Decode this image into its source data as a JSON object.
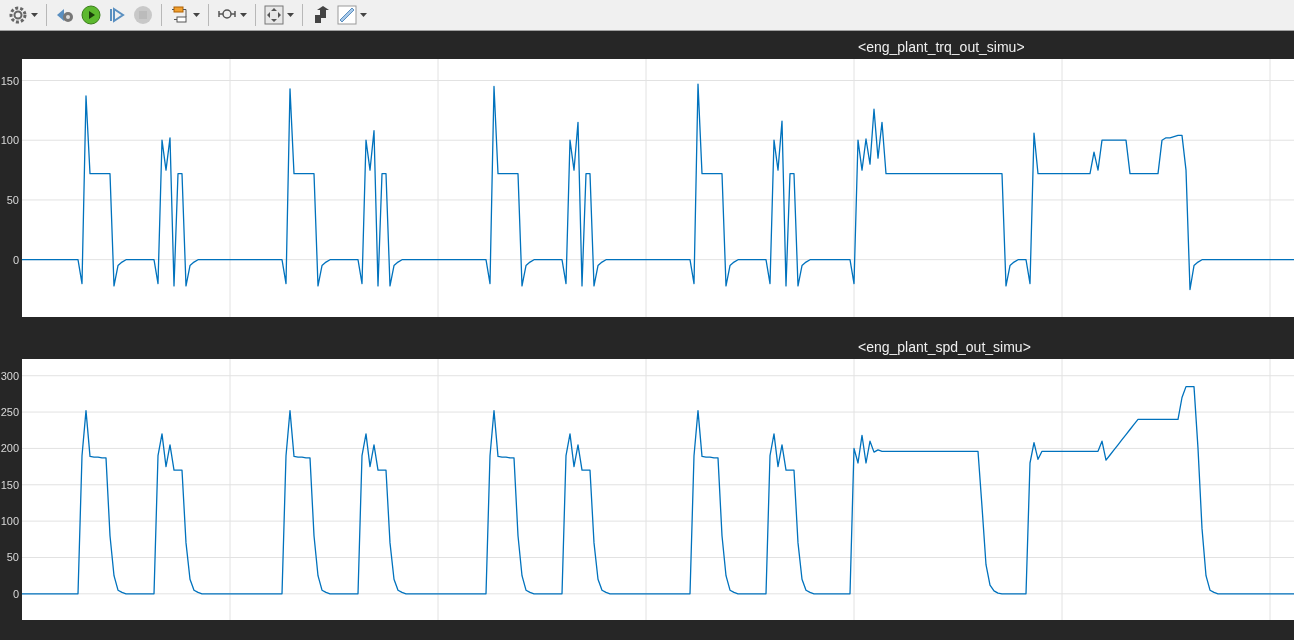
{
  "toolbar": {
    "groups": [
      [
        {
          "kind": "settings",
          "dropdown": true,
          "disabled": false
        }
      ],
      [
        {
          "kind": "step-back",
          "dropdown": false,
          "disabled": false
        },
        {
          "kind": "run",
          "dropdown": false,
          "disabled": false
        },
        {
          "kind": "step-forward",
          "dropdown": false,
          "disabled": false
        },
        {
          "kind": "stop",
          "dropdown": false,
          "disabled": true
        }
      ],
      [
        {
          "kind": "blocks",
          "dropdown": true,
          "disabled": false
        }
      ],
      [
        {
          "kind": "zoom",
          "dropdown": true,
          "disabled": false
        }
      ],
      [
        {
          "kind": "fit",
          "dropdown": true,
          "disabled": false
        }
      ],
      [
        {
          "kind": "style",
          "dropdown": false,
          "disabled": false
        },
        {
          "kind": "ruler",
          "dropdown": true,
          "disabled": false
        }
      ]
    ]
  },
  "plots": [
    {
      "title": "<eng_plant_trq_out_simu>",
      "chart_data": {
        "type": "line",
        "grid": true,
        "ylim": [
          -48,
          168
        ],
        "yticks": [
          {
            "value": 0,
            "label": "0"
          },
          {
            "value": 50,
            "label": "50"
          },
          {
            "value": 100,
            "label": "100"
          },
          {
            "value": 150,
            "label": "150"
          }
        ],
        "categories": [
          null,
          null,
          null,
          null,
          null,
          null,
          null,
          null,
          null,
          null,
          null,
          null,
          null,
          null,
          null,
          null,
          null,
          null,
          null,
          null,
          null,
          null,
          null,
          null,
          null,
          null,
          null,
          null,
          null,
          null,
          null,
          null,
          null,
          null,
          null,
          null,
          null,
          null,
          null,
          null,
          null,
          null,
          null,
          null,
          null,
          null,
          null,
          null,
          null,
          null,
          null,
          null,
          null,
          null,
          null,
          null,
          null,
          null,
          null,
          null,
          null,
          null,
          null,
          null,
          null,
          null,
          null,
          null,
          null,
          null,
          null,
          null,
          null,
          null,
          null,
          null,
          null,
          null,
          null,
          null,
          null,
          null,
          null,
          null,
          null,
          null,
          null,
          null,
          null,
          null,
          null,
          null,
          null,
          null,
          null,
          null,
          null,
          null,
          null,
          null,
          null,
          null,
          null,
          null,
          null,
          null,
          null,
          null,
          null,
          null,
          null,
          null,
          null,
          null,
          null,
          null,
          null,
          null,
          null,
          null,
          null,
          null,
          null,
          null,
          null,
          null,
          null,
          null,
          null,
          null,
          null,
          null,
          null,
          null,
          null,
          null,
          null,
          null,
          null,
          null,
          null,
          null,
          null,
          null,
          null,
          null,
          null,
          null,
          null,
          null,
          null,
          null,
          null,
          null,
          null,
          null,
          null,
          null,
          null,
          null,
          null,
          null,
          null,
          null,
          null,
          null,
          null,
          null,
          null,
          null,
          null,
          null,
          null,
          null,
          null,
          null,
          null,
          null,
          null,
          null,
          null,
          null,
          null,
          null,
          null,
          null,
          null,
          null,
          null,
          null,
          null,
          null,
          null,
          null,
          null,
          null,
          null,
          null,
          null,
          null,
          null,
          null,
          null,
          null,
          null,
          null,
          null,
          null,
          null,
          null,
          null,
          null,
          null,
          null,
          null,
          null,
          null,
          null,
          null,
          null,
          null,
          null,
          null,
          null,
          null,
          null,
          null,
          null,
          null,
          null,
          null,
          null,
          null,
          null,
          null,
          null,
          null,
          null,
          null,
          null,
          null,
          null,
          null,
          null,
          null,
          null,
          null,
          null,
          null,
          null,
          null,
          null,
          null,
          null,
          null,
          null,
          null,
          null,
          null,
          null,
          null,
          null,
          null,
          null,
          null,
          null,
          null,
          null,
          null,
          null,
          null,
          null,
          null,
          null,
          null,
          null,
          null,
          null,
          null,
          null,
          null,
          null,
          null,
          null,
          null,
          null,
          null,
          null,
          null,
          null,
          null,
          null,
          null,
          null,
          null,
          null,
          null,
          null,
          null,
          null,
          null,
          null,
          null,
          null,
          null,
          null,
          null,
          null,
          null,
          null,
          null,
          null,
          null,
          null,
          null,
          null,
          null,
          null,
          null
        ],
        "series": [
          {
            "color": "#0072bd",
            "values": [
              0,
              0,
              0,
              0,
              0,
              0,
              0,
              0,
              0,
              0,
              0,
              0,
              0,
              0,
              0,
              -20,
              137,
              72,
              72,
              72,
              72,
              72,
              72,
              -22,
              -5,
              -2,
              0,
              0,
              0,
              0,
              0,
              0,
              0,
              0,
              -20,
              100,
              75,
              102,
              -22,
              72,
              72,
              -22,
              -5,
              -2,
              0,
              0,
              0,
              0,
              0,
              0,
              0,
              0,
              0,
              0,
              0,
              0,
              0,
              0,
              0,
              0,
              0,
              0,
              0,
              0,
              0,
              0,
              -20,
              143,
              72,
              72,
              72,
              72,
              72,
              72,
              -22,
              -5,
              -2,
              0,
              0,
              0,
              0,
              0,
              0,
              0,
              0,
              -20,
              100,
              75,
              108,
              -22,
              72,
              72,
              -22,
              -5,
              -2,
              0,
              0,
              0,
              0,
              0,
              0,
              0,
              0,
              0,
              0,
              0,
              0,
              0,
              0,
              0,
              0,
              0,
              0,
              0,
              0,
              0,
              0,
              -20,
              145,
              72,
              72,
              72,
              72,
              72,
              72,
              -22,
              -5,
              -2,
              0,
              0,
              0,
              0,
              0,
              0,
              0,
              0,
              -20,
              100,
              75,
              115,
              -22,
              72,
              72,
              -22,
              -5,
              -2,
              0,
              0,
              0,
              0,
              0,
              0,
              0,
              0,
              0,
              0,
              0,
              0,
              0,
              0,
              0,
              0,
              0,
              0,
              0,
              0,
              0,
              0,
              -20,
              147,
              72,
              72,
              72,
              72,
              72,
              72,
              -22,
              -5,
              -2,
              0,
              0,
              0,
              0,
              0,
              0,
              0,
              0,
              -20,
              100,
              75,
              116,
              -22,
              72,
              72,
              -22,
              -5,
              -2,
              0,
              0,
              0,
              0,
              0,
              0,
              0,
              0,
              0,
              0,
              0,
              -20,
              100,
              75,
              101,
              80,
              126,
              85,
              115,
              72,
              72,
              72,
              72,
              72,
              72,
              72,
              72,
              72,
              72,
              72,
              72,
              72,
              72,
              72,
              72,
              72,
              72,
              72,
              72,
              72,
              72,
              72,
              72,
              72,
              72,
              72,
              72,
              72,
              72,
              -22,
              -5,
              -2,
              0,
              0,
              0,
              -20,
              106,
              72,
              72,
              72,
              72,
              72,
              72,
              72,
              72,
              72,
              72,
              72,
              72,
              72,
              72,
              90,
              75,
              100,
              100,
              100,
              100,
              100,
              100,
              100,
              72,
              72,
              72,
              72,
              72,
              72,
              72,
              72,
              100,
              102,
              102,
              103,
              104,
              104,
              75,
              -25,
              -5,
              -2,
              0,
              0,
              0,
              0,
              0,
              0,
              0,
              0,
              0,
              0,
              0,
              0,
              0,
              0,
              0,
              0,
              0,
              0,
              0,
              0,
              0,
              0,
              0,
              0
            ]
          }
        ]
      }
    },
    {
      "title": "<eng_plant_spd_out_simu>",
      "chart_data": {
        "type": "line",
        "grid": true,
        "ylim": [
          -36,
          323
        ],
        "yticks": [
          {
            "value": 0,
            "label": "0"
          },
          {
            "value": 50,
            "label": "50"
          },
          {
            "value": 100,
            "label": "100"
          },
          {
            "value": 150,
            "label": "150"
          },
          {
            "value": 200,
            "label": "200"
          },
          {
            "value": 250,
            "label": "250"
          },
          {
            "value": 300,
            "label": "300"
          }
        ],
        "categories": [
          null,
          null,
          null,
          null,
          null,
          null,
          null,
          null,
          null,
          null,
          null,
          null,
          null,
          null,
          null,
          null,
          null,
          null,
          null,
          null,
          null,
          null,
          null,
          null,
          null,
          null,
          null,
          null,
          null,
          null,
          null,
          null,
          null,
          null,
          null,
          null,
          null,
          null,
          null,
          null,
          null,
          null,
          null,
          null,
          null,
          null,
          null,
          null,
          null,
          null,
          null,
          null,
          null,
          null,
          null,
          null,
          null,
          null,
          null,
          null,
          null,
          null,
          null,
          null,
          null,
          null,
          null,
          null,
          null,
          null,
          null,
          null,
          null,
          null,
          null,
          null,
          null,
          null,
          null,
          null,
          null,
          null,
          null,
          null,
          null,
          null,
          null,
          null,
          null,
          null,
          null,
          null,
          null,
          null,
          null,
          null,
          null,
          null,
          null,
          null,
          null,
          null,
          null,
          null,
          null,
          null,
          null,
          null,
          null,
          null,
          null,
          null,
          null,
          null,
          null,
          null,
          null,
          null,
          null,
          null,
          null,
          null,
          null,
          null,
          null,
          null,
          null,
          null,
          null,
          null,
          null,
          null,
          null,
          null,
          null,
          null,
          null,
          null,
          null,
          null,
          null,
          null,
          null,
          null,
          null,
          null,
          null,
          null,
          null,
          null,
          null,
          null,
          null,
          null,
          null,
          null,
          null,
          null,
          null,
          null,
          null,
          null,
          null,
          null,
          null,
          null,
          null,
          null,
          null,
          null,
          null,
          null,
          null,
          null,
          null,
          null,
          null,
          null,
          null,
          null,
          null,
          null,
          null,
          null,
          null,
          null,
          null,
          null,
          null,
          null,
          null,
          null,
          null,
          null,
          null,
          null,
          null,
          null,
          null,
          null,
          null,
          null,
          null,
          null,
          null,
          null,
          null,
          null,
          null,
          null,
          null,
          null,
          null,
          null,
          null,
          null,
          null,
          null,
          null,
          null,
          null,
          null,
          null,
          null,
          null,
          null,
          null,
          null,
          null,
          null,
          null,
          null,
          null,
          null,
          null,
          null,
          null,
          null,
          null,
          null,
          null,
          null,
          null,
          null,
          null,
          null,
          null,
          null,
          null,
          null,
          null,
          null,
          null,
          null,
          null,
          null,
          null,
          null,
          null,
          null,
          null,
          null,
          null,
          null,
          null,
          null,
          null,
          null,
          null,
          null,
          null,
          null,
          null,
          null,
          null,
          null,
          null,
          null,
          null,
          null,
          null,
          null,
          null,
          null,
          null,
          null,
          null,
          null,
          null,
          null,
          null,
          null,
          null,
          null,
          null,
          null,
          null,
          null,
          null,
          null,
          null,
          null,
          null,
          null,
          null,
          null,
          null,
          null,
          null,
          null,
          null,
          null,
          null,
          null,
          null,
          null,
          null,
          null,
          null
        ],
        "series": [
          {
            "color": "#0072bd",
            "values": [
              0,
              0,
              0,
              0,
              0,
              0,
              0,
              0,
              0,
              0,
              0,
              0,
              0,
              0,
              0,
              190,
              252,
              189,
              188,
              188,
              187,
              187,
              80,
              25,
              5,
              2,
              0,
              0,
              0,
              0,
              0,
              0,
              0,
              0,
              190,
              220,
              175,
              205,
              170,
              170,
              170,
              70,
              20,
              5,
              2,
              0,
              0,
              0,
              0,
              0,
              0,
              0,
              0,
              0,
              0,
              0,
              0,
              0,
              0,
              0,
              0,
              0,
              0,
              0,
              0,
              0,
              190,
              252,
              189,
              188,
              188,
              187,
              187,
              80,
              25,
              5,
              2,
              0,
              0,
              0,
              0,
              0,
              0,
              0,
              0,
              190,
              220,
              175,
              205,
              170,
              170,
              170,
              70,
              20,
              5,
              2,
              0,
              0,
              0,
              0,
              0,
              0,
              0,
              0,
              0,
              0,
              0,
              0,
              0,
              0,
              0,
              0,
              0,
              0,
              0,
              0,
              0,
              190,
              252,
              189,
              188,
              188,
              187,
              187,
              80,
              25,
              5,
              2,
              0,
              0,
              0,
              0,
              0,
              0,
              0,
              0,
              190,
              220,
              175,
              205,
              170,
              170,
              170,
              70,
              20,
              5,
              2,
              0,
              0,
              0,
              0,
              0,
              0,
              0,
              0,
              0,
              0,
              0,
              0,
              0,
              0,
              0,
              0,
              0,
              0,
              0,
              0,
              0,
              190,
              252,
              189,
              188,
              188,
              187,
              187,
              80,
              25,
              5,
              2,
              0,
              0,
              0,
              0,
              0,
              0,
              0,
              0,
              190,
              220,
              175,
              205,
              170,
              170,
              170,
              70,
              20,
              5,
              2,
              0,
              0,
              0,
              0,
              0,
              0,
              0,
              0,
              0,
              0,
              200,
              180,
              218,
              180,
              210,
              195,
              198,
              196,
              196,
              196,
              196,
              196,
              196,
              196,
              196,
              196,
              196,
              196,
              196,
              196,
              196,
              196,
              196,
              196,
              196,
              196,
              196,
              196,
              196,
              196,
              196,
              196,
              120,
              40,
              12,
              4,
              1,
              0,
              0,
              0,
              0,
              0,
              0,
              0,
              180,
              208,
              185,
              196,
              196,
              196,
              196,
              196,
              196,
              196,
              196,
              196,
              196,
              196,
              196,
              196,
              196,
              196,
              210,
              184,
              191,
              198,
              205,
              212,
              219,
              226,
              233,
              240,
              240,
              240,
              240,
              240,
              240,
              240,
              240,
              240,
              240,
              240,
              270,
              285,
              285,
              285,
              200,
              90,
              25,
              5,
              2,
              0,
              0,
              0,
              0,
              0,
              0,
              0,
              0,
              0,
              0,
              0,
              0,
              0,
              0,
              0,
              0,
              0,
              0,
              0,
              0
            ]
          }
        ]
      }
    }
  ]
}
